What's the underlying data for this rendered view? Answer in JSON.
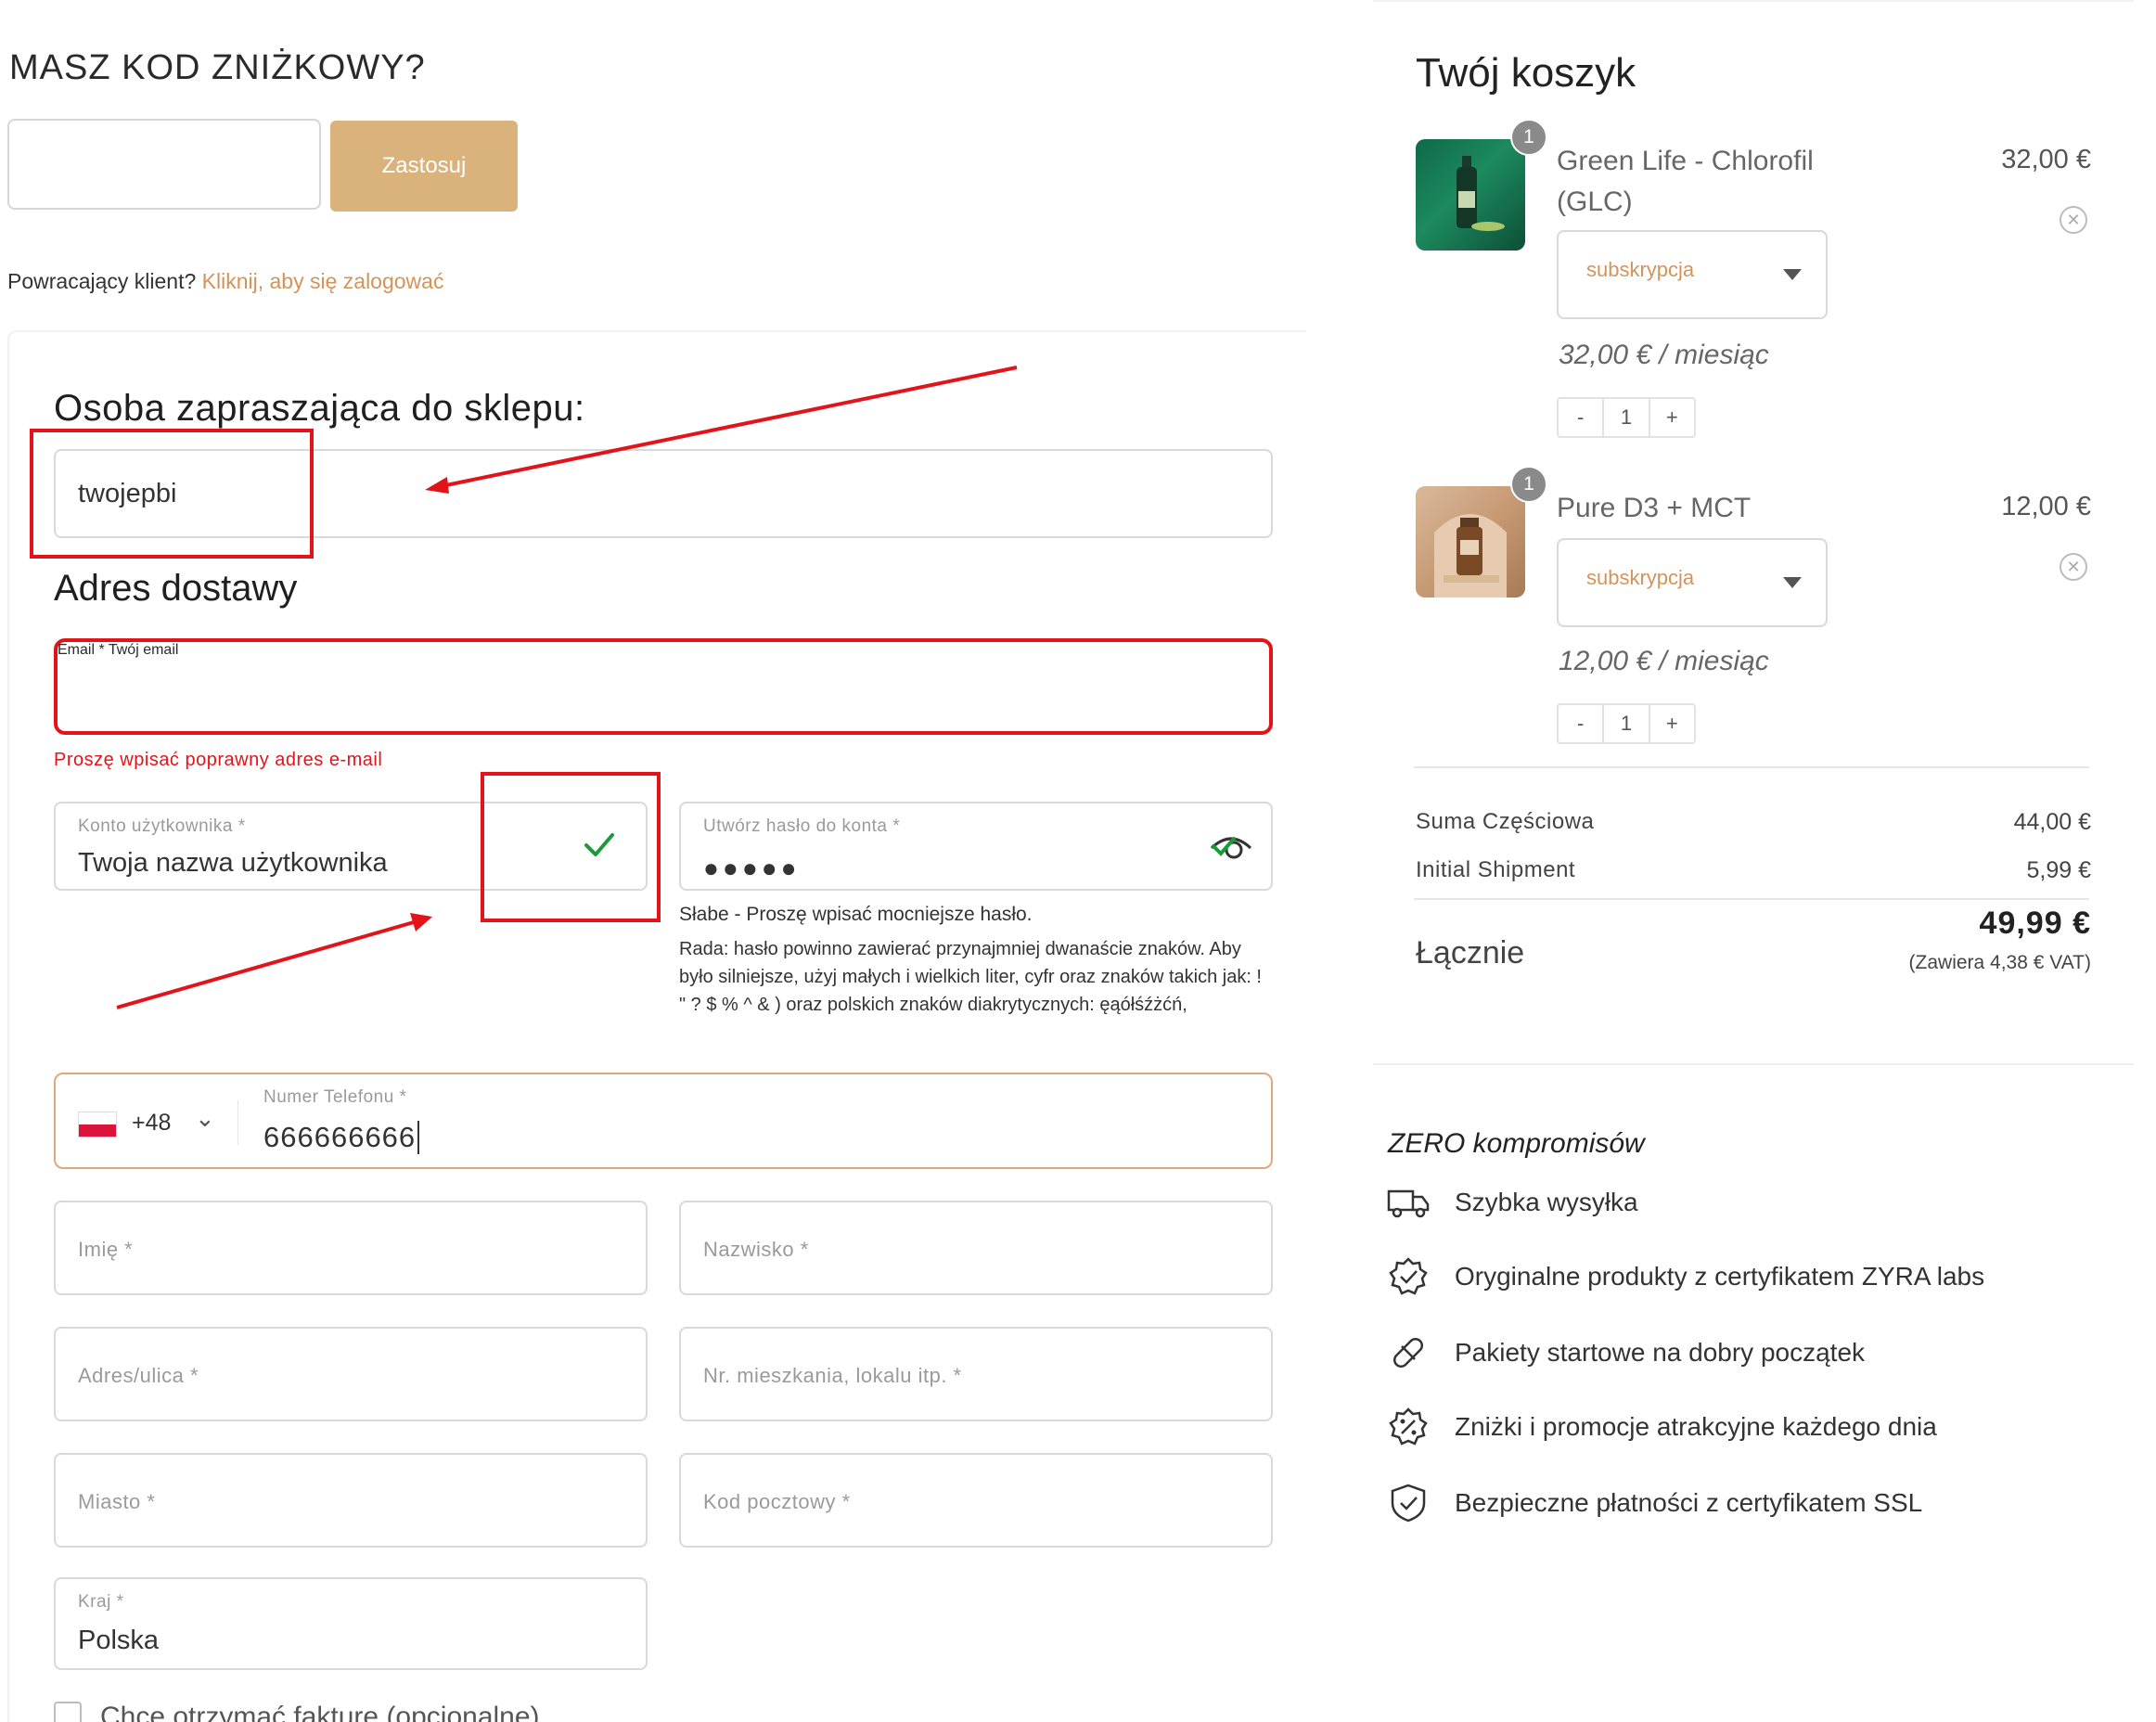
{
  "discount": {
    "title": "MASZ KOD ZNIŻKOWY?",
    "input_value": "",
    "apply_label": "Zastosuj"
  },
  "returning": {
    "text": "Powracający klient?",
    "link": "Kliknij, aby się zalogować"
  },
  "referral": {
    "title": "Osoba zapraszająca do sklepu:",
    "value": "twojepbi"
  },
  "delivery": {
    "title": "Adres dostawy",
    "email": {
      "label": "Email *",
      "value": "Twój email",
      "error": "Proszę wpisać poprawny adres e-mail"
    },
    "username": {
      "label": "Konto użytkownika *",
      "value": "Twoja nazwa użytkownika"
    },
    "password": {
      "label": "Utwórz hasło do konta *",
      "dots": "●●●●●",
      "strength": "Słabe - Proszę wpisać mocniejsze hasło.",
      "hint": "Rada: hasło powinno zawierać przynajmniej dwanaście znaków. Aby było silniejsze, użyj małych i wielkich liter, cyfr oraz znaków takich jak: ! \" ? $ % ^ & ) oraz polskich znaków diakrytycznych: ęąółśźżćń,"
    },
    "phone": {
      "dial_code": "+48",
      "label": "Numer Telefonu *",
      "value": "666666666"
    },
    "first_name_ph": "Imię *",
    "last_name_ph": "Nazwisko *",
    "street_ph": "Adres/ulica *",
    "apartment_ph": "Nr. mieszkania, lokalu itp. *",
    "city_ph": "Miasto *",
    "postcode_ph": "Kod pocztowy *",
    "country": {
      "label": "Kraj *",
      "value": "Polska"
    },
    "invoice_label": "Chcę otrzymać fakturę (opcjonalne)"
  },
  "cart": {
    "title": "Twój koszyk",
    "items": [
      {
        "qty_badge": "1",
        "name": "Green Life - Chlorofil (GLC)",
        "price": "32,00 €",
        "subscription": "subskrypcja",
        "monthly": "32,00 € / miesiąc",
        "qty": "1"
      },
      {
        "qty_badge": "1",
        "name": "Pure D3 + MCT",
        "price": "12,00 €",
        "subscription": "subskrypcja",
        "monthly": "12,00 € / miesiąc",
        "qty": "1"
      }
    ],
    "stepper": {
      "minus": "-",
      "plus": "+"
    },
    "subtotal": {
      "label": "Suma Częściowa",
      "value": "44,00 €"
    },
    "shipping": {
      "label": "Initial Shipment",
      "value": "5,99 €"
    },
    "total": {
      "label": "Łącznie",
      "value": "49,99 €",
      "vat": "(Zawiera 4,38 € VAT)"
    }
  },
  "features": {
    "title": "ZERO kompromisów",
    "items": [
      {
        "icon": "truck-icon",
        "text": "Szybka wysyłka"
      },
      {
        "icon": "badge-check-icon",
        "text": "Oryginalne produkty z certyfikatem ZYRA labs"
      },
      {
        "icon": "pill-icon",
        "text": "Pakiety startowe na dobry początek"
      },
      {
        "icon": "percent-badge-icon",
        "text": "Zniżki i promocje atrakcyjne każdego dnia"
      },
      {
        "icon": "shield-check-icon",
        "text": "Bezpieczne płatności z certyfikatem SSL"
      }
    ]
  },
  "colors": {
    "accent": "#d9b27c",
    "link": "#d59359",
    "error": "#e2141a",
    "valid": "#1a9a3a"
  }
}
